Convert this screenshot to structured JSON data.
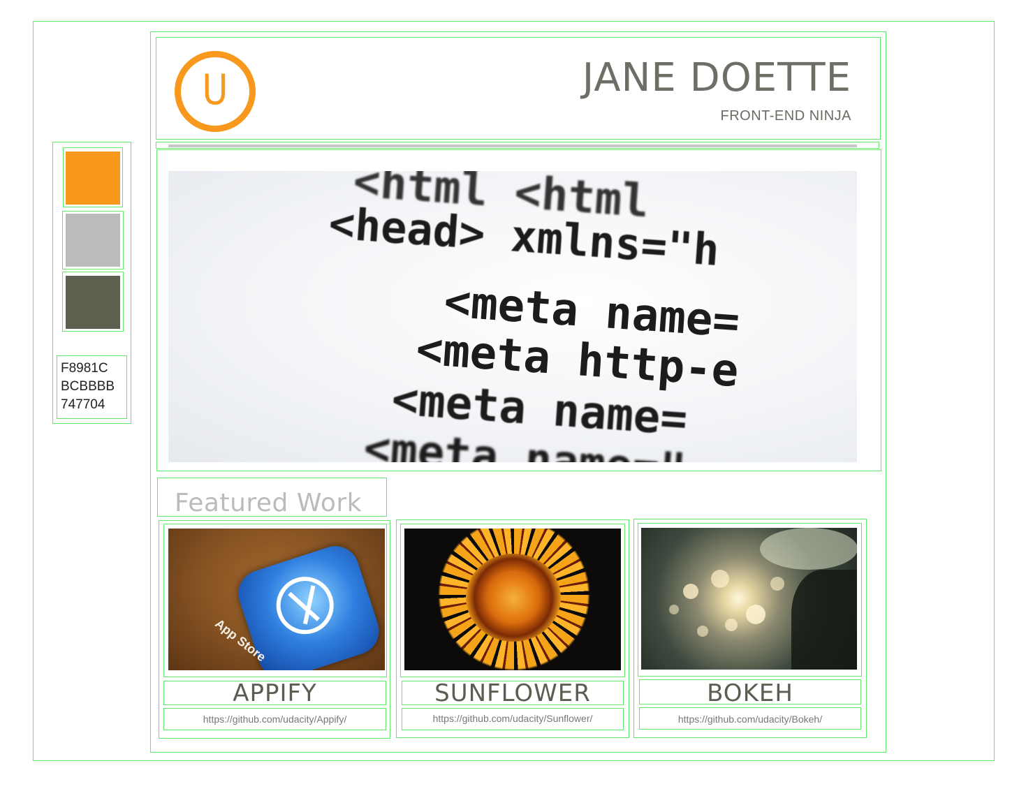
{
  "header": {
    "logo_letter": "U",
    "name": "JANE DOETTE",
    "role": "FRONT-END NINJA"
  },
  "hero": {
    "code_lines": [
      "<html   <html",
      "<head>    xmlns=\"h",
      "<meta  name=",
      "<meta  http-e",
      "<meta  name=",
      "<meta  name=\""
    ]
  },
  "featured": {
    "title": "Featured Work",
    "items": [
      {
        "title": "APPIFY",
        "link": "https://github.com/udacity/Appify/",
        "thumb_text": "App Store"
      },
      {
        "title": "SUNFLOWER",
        "link": "https://github.com/udacity/Sunflower/"
      },
      {
        "title": "BOKEH",
        "link": "https://github.com/udacity/Bokeh/"
      }
    ]
  },
  "palette": {
    "colors": [
      "#F8981C",
      "#BCBBBB",
      "#5E5F4E"
    ],
    "codes": [
      "F8981C",
      "BCBBBB",
      "747704"
    ]
  }
}
